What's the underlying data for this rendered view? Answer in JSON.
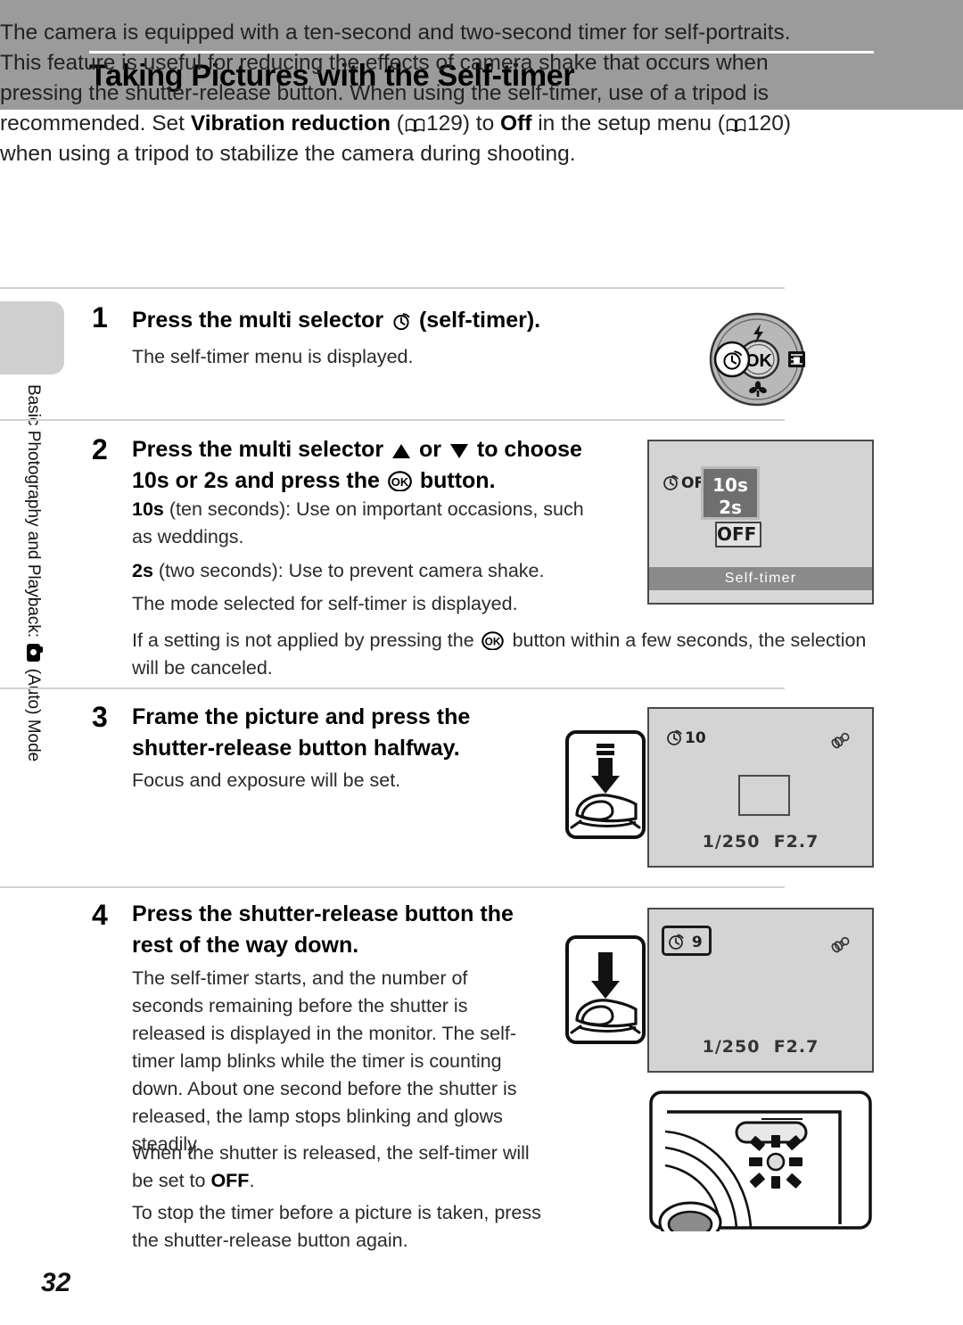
{
  "page": {
    "number": "32",
    "sidebar_label": "Basic Photography and Playback:",
    "sidebar_label_tail": "(Auto) Mode",
    "sidebar_icon": "camera-auto-icon"
  },
  "header": {
    "title": "Taking Pictures with the Self-timer"
  },
  "intro": {
    "part1": "The camera is equipped with a ten-second and two-second timer for self-portraits. This feature is useful for reducing the effects of camera shake that occurs when pressing the shutter-release button. When using the self-timer, use of a tripod is recommended. Set ",
    "bold1": "Vibration reduction",
    "ref1": "129",
    "part2": ") to ",
    "bold2": "Off",
    "part3": " in the setup menu (",
    "ref2": "120",
    "part4": ") when using a tripod to stabilize the camera during shooting.",
    "open_paren": " ("
  },
  "steps": [
    {
      "number": "1",
      "heading_pre": "Press the multi selector ",
      "heading_post": " (self-timer).",
      "body": "The self-timer menu is displayed."
    },
    {
      "number": "2",
      "heading_a": "Press the multi selector ",
      "heading_b": " or ",
      "heading_c": " to choose",
      "heading_d": "10s",
      "heading_e": " or ",
      "heading_f": "2s",
      "heading_g": " and press the ",
      "heading_h": " button.",
      "body1_bold": "10s",
      "body1": " (ten seconds): Use on important occasions, such as weddings.",
      "body2_bold": "2s",
      "body2": " (two seconds): Use to prevent camera shake.",
      "body3": "The mode selected for self-timer is displayed.",
      "body4_pre": "If a setting is not applied by pressing the ",
      "body4_post": " button within a few seconds, the selection will be canceled."
    },
    {
      "number": "3",
      "heading": "Frame the picture and press the shutter-release button halfway.",
      "body": "Focus and exposure will be set."
    },
    {
      "number": "4",
      "heading": "Press the shutter-release button the rest of the way down.",
      "body1": "The self-timer starts, and the number of seconds remaining before the shutter is released is displayed in the monitor. The self-timer lamp blinks while the timer is counting down. About one second before the shutter is released, the lamp stops blinking and glows steadily.",
      "body2_pre": "When the shutter is released, the self-timer will be set to ",
      "body2_bold": "OFF",
      "body2_post": ".",
      "body3": "To stop the timer before a picture is taken, press the shutter-release button again."
    }
  ],
  "multi_selector": {
    "name": "multi-selector-dial",
    "top_icon": "flash-icon",
    "left_icon": "self-timer-icon",
    "right_icon": "exposure-compensation-icon",
    "bottom_icon": "macro-flower-icon",
    "center_label": "OK"
  },
  "lcd_step2": {
    "status_icon_label": "OFF",
    "options": [
      "10s",
      "2s",
      "OFF"
    ],
    "selected_option": "OFF",
    "title_bar": "Self-timer"
  },
  "lcd_step3": {
    "timer_indicator": "10",
    "shutter_speed": "1/250",
    "aperture": "F2.7"
  },
  "lcd_step4": {
    "timer_indicator": "9",
    "shutter_speed": "1/250",
    "aperture": "F2.7"
  },
  "colors": {
    "header_band": "#9b9b9b",
    "side_tab": "#cfcfcf",
    "lcd_background": "#d4d4d4",
    "lcd_title_bar": "#8a8a8a",
    "menu_box": "#6f6f6f",
    "rule": "#d2d2d2"
  }
}
